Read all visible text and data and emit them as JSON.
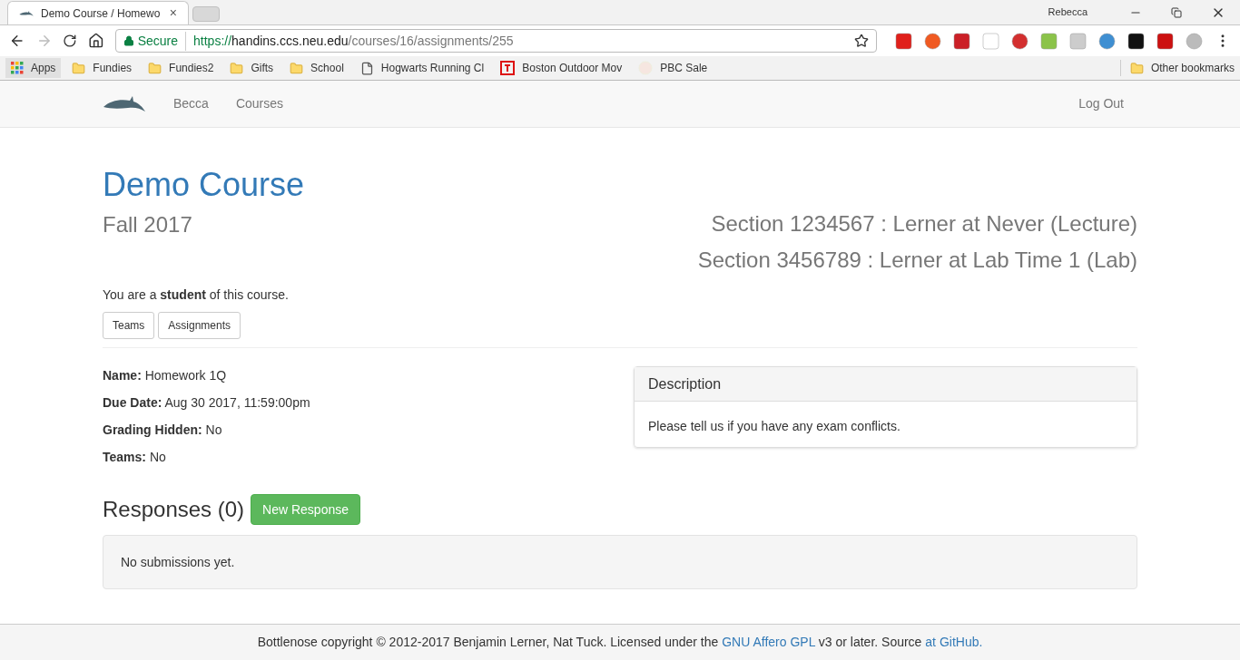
{
  "browser": {
    "tabs": [
      {
        "title": "Demo Course / Homewo",
        "selected": true,
        "close": "×"
      }
    ],
    "profile": "Rebecca",
    "secure_label": "Secure",
    "url": {
      "scheme": "https://",
      "host": "handins.ccs.neu.edu",
      "path": "/courses/16/assignments/255"
    },
    "bookmarks": [
      {
        "kind": "apps",
        "label": "Apps"
      },
      {
        "kind": "folder",
        "label": "Fundies"
      },
      {
        "kind": "folder",
        "label": "Fundies2"
      },
      {
        "kind": "folder",
        "label": "Gifts"
      },
      {
        "kind": "folder",
        "label": "School"
      },
      {
        "kind": "page",
        "label": "Hogwarts Running Cl"
      },
      {
        "kind": "tile",
        "label": "Boston Outdoor Mov"
      },
      {
        "kind": "faded",
        "label": "PBC Sale"
      }
    ],
    "other_bookmarks": "Other bookmarks"
  },
  "navbar": {
    "links": [
      "Becca",
      "Courses"
    ],
    "logout": "Log Out"
  },
  "course": {
    "title": "Demo Course",
    "term": "Fall 2017",
    "sections": [
      "Section 1234567 : Lerner at Never (Lecture)",
      "Section 3456789 : Lerner at Lab Time 1 (Lab)"
    ],
    "role_text": "You are a **student** of this course.",
    "buttons": [
      "Teams",
      "Assignments"
    ]
  },
  "assignment": {
    "fields": [
      {
        "label": "Name:",
        "value": "Homework 1Q"
      },
      {
        "label": "Due Date:",
        "value": "Aug 30 2017, 11:59:00pm"
      },
      {
        "label": "Grading Hidden:",
        "value": "No"
      },
      {
        "label": "Teams:",
        "value": "No"
      }
    ],
    "description": {
      "heading": "Description",
      "body": "Please tell us if you have any exam conflicts."
    }
  },
  "responses": {
    "heading": "Responses (0)",
    "new_button": "New Response",
    "empty": "No submissions yet."
  },
  "footer": [
    {
      "kind": "text",
      "text": "Bottlenose copyright © 2012-2017 Benjamin Lerner, Nat Tuck. Licensed under the "
    },
    {
      "kind": "link",
      "text": "GNU Affero GPL"
    },
    {
      "kind": "text",
      "text": " v3 or later. Source "
    },
    {
      "kind": "link",
      "text": "at GitHub."
    }
  ]
}
